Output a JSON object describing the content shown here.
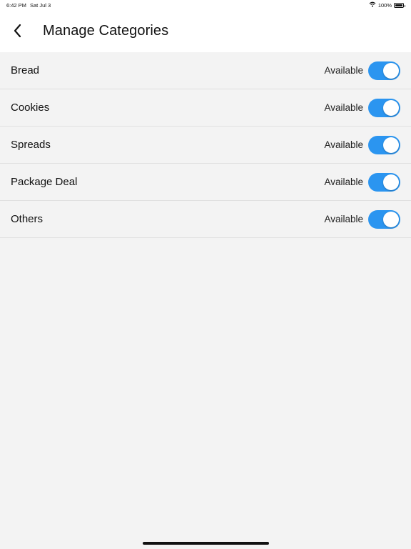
{
  "status_bar": {
    "time": "6:42 PM",
    "date": "Sat Jul 3",
    "battery": "100%"
  },
  "header": {
    "title": "Manage Categories"
  },
  "categories": [
    {
      "name": "Bread",
      "status": "Available",
      "enabled": true
    },
    {
      "name": "Cookies",
      "status": "Available",
      "enabled": true
    },
    {
      "name": "Spreads",
      "status": "Available",
      "enabled": true
    },
    {
      "name": "Package Deal",
      "status": "Available",
      "enabled": true
    },
    {
      "name": "Others",
      "status": "Available",
      "enabled": true
    }
  ],
  "colors": {
    "toggle_on": "#2b95f0",
    "background": "#f3f3f3"
  }
}
